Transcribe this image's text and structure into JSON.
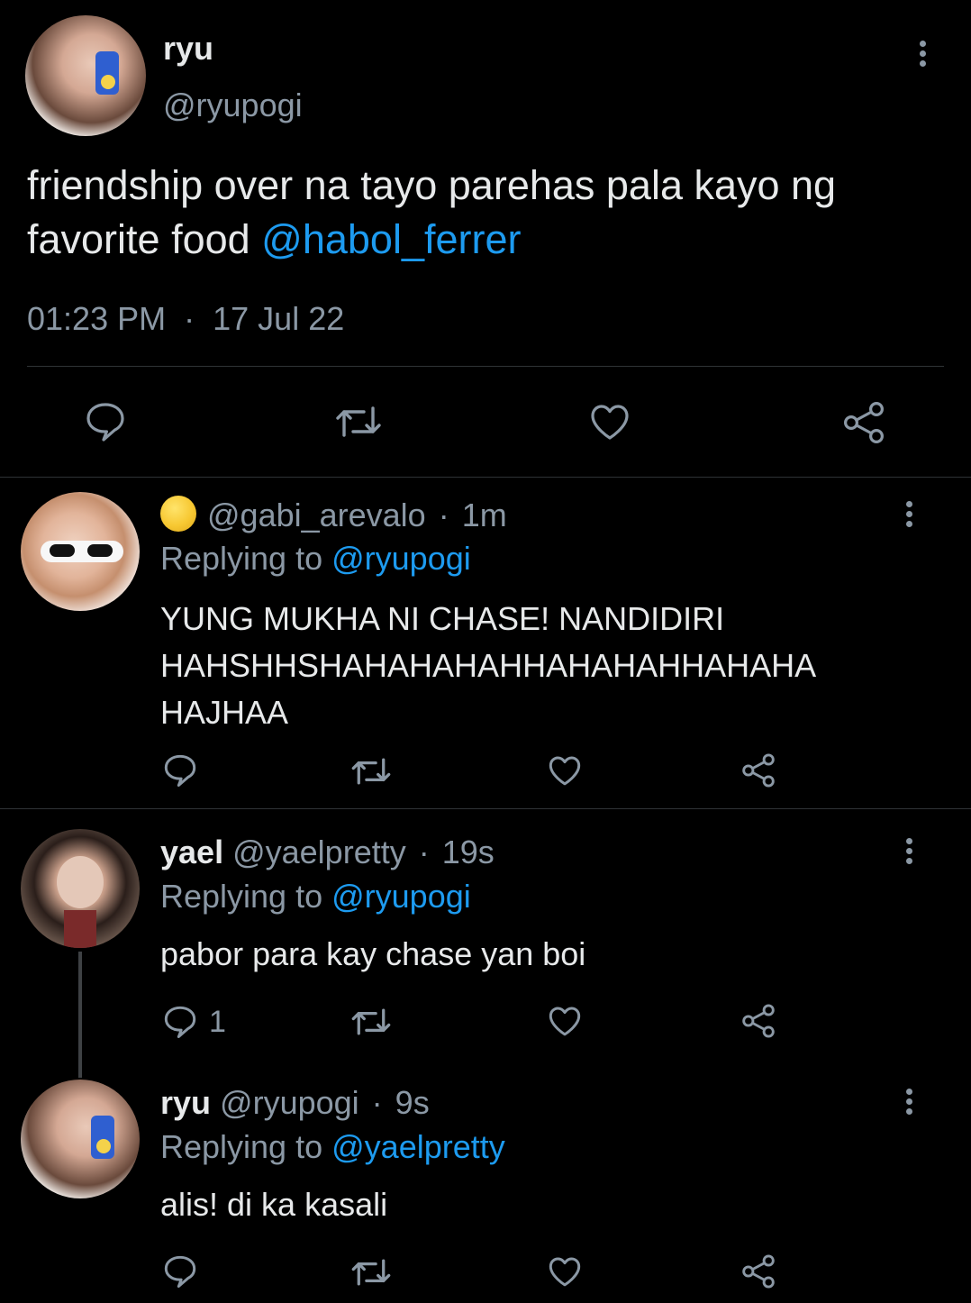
{
  "main_tweet": {
    "display_name": "ryu",
    "handle": "@ryupogi",
    "text": "friendship over na tayo parehas pala kayo ng favorite food",
    "mention": "@habol_ferrer",
    "time": "01:23 PM",
    "separator": "·",
    "date": "17 Jul 22"
  },
  "replies": [
    {
      "emoji": "yellow-face-emoji",
      "handle": "@gabi_arevalo",
      "separator": "·",
      "time": "1m",
      "replying_label": "Replying to",
      "replying_to": "@ryupogi",
      "text_lines": [
        "YUNG MUKHA NI CHASE! NANDIDIRI",
        "HAHSHHSHAHAHAHAHHAHAHAHHAHAHA",
        "HAJHAA"
      ],
      "reply_count": ""
    },
    {
      "display_name": "yael",
      "handle": "@yaelpretty",
      "separator": "·",
      "time": "19s",
      "replying_label": "Replying to",
      "replying_to": "@ryupogi",
      "text": "pabor para kay chase yan boi",
      "reply_count": "1"
    },
    {
      "display_name": "ryu",
      "handle": "@ryupogi",
      "separator": "·",
      "time": "9s",
      "replying_label": "Replying to",
      "replying_to": "@yaelpretty",
      "text": "alis! di ka kasali",
      "reply_count": ""
    }
  ],
  "colors": {
    "background": "#000000",
    "text": "#e7e9ea",
    "muted": "#8b98a5",
    "link": "#1d9bf0",
    "divider": "#2f3336"
  }
}
